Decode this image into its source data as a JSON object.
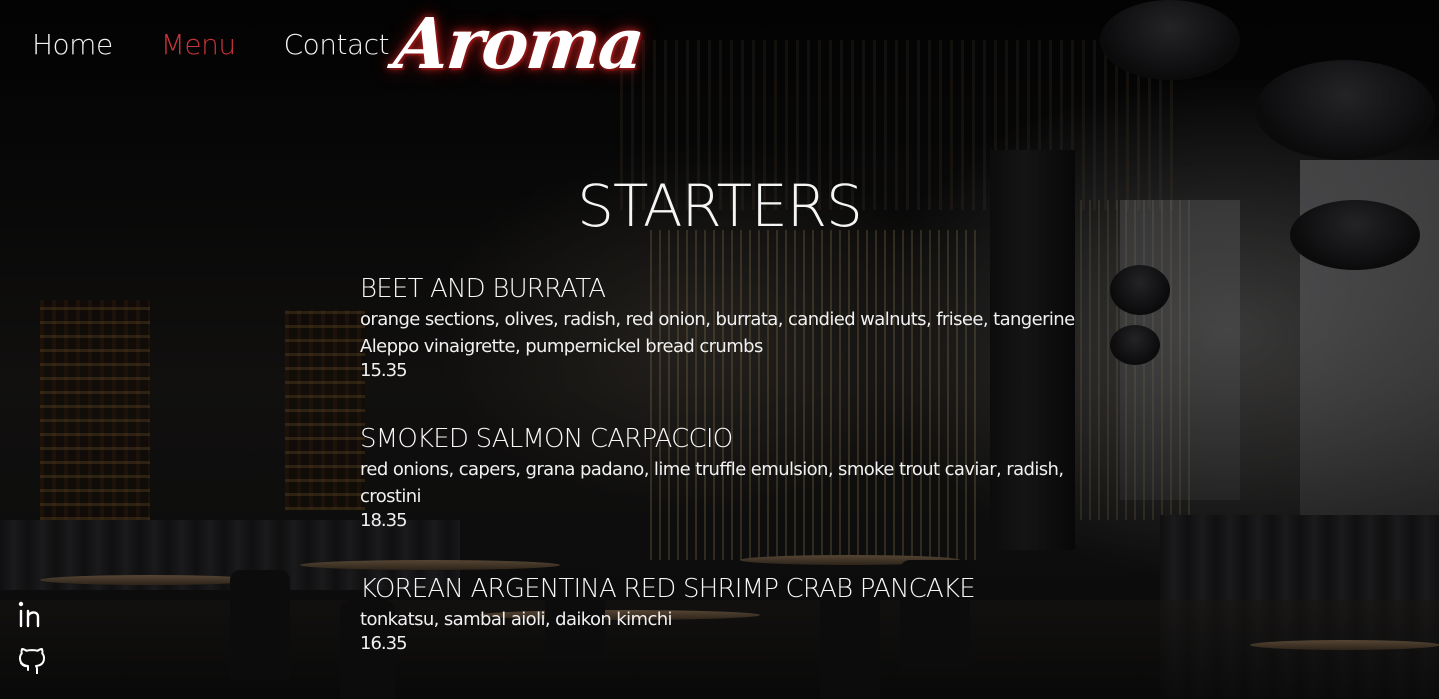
{
  "nav": {
    "links": [
      {
        "label": "Home",
        "active": false
      },
      {
        "label": "Menu",
        "active": true
      },
      {
        "label": "Contact",
        "active": false
      }
    ],
    "logo": "Aroma"
  },
  "menu": {
    "section_title": "STARTERS",
    "items": [
      {
        "name": "BEET AND BURRATA",
        "description": "orange sections, olives, radish, red onion, burrata, candied walnuts, frisee, tangerine Aleppo vinaigrette, pumpernickel bread crumbs",
        "price": "15.35"
      },
      {
        "name": "SMOKED SALMON CARPACCIO",
        "description": "red onions, capers, grana padano, lime truffle emulsion, smoke trout caviar, radish, crostini",
        "price": "18.35"
      },
      {
        "name": "KOREAN ARGENTINA RED SHRIMP CRAB PANCAKE",
        "description": "tonkatsu, sambal aioli, daikon kimchi",
        "price": "16.35"
      }
    ]
  },
  "social": {
    "icons": [
      "linkedin-icon",
      "github-icon"
    ]
  },
  "colors": {
    "accent": "#c9343a",
    "text": "#f2f2f2"
  }
}
